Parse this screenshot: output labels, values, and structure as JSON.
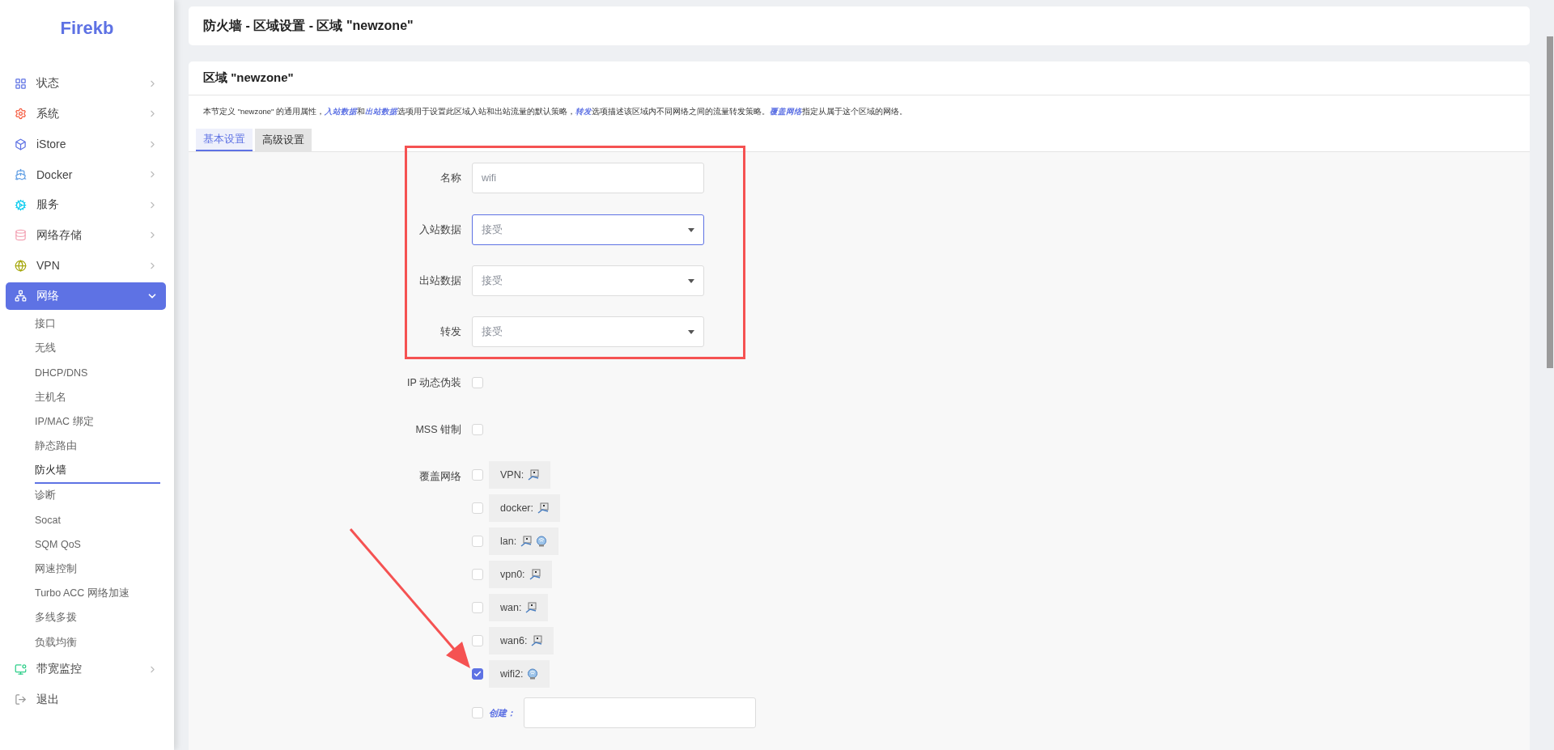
{
  "brand": "Firekb",
  "sidebar": {
    "items": [
      {
        "label": "状态",
        "kind": "menu",
        "expanded": false,
        "selected": false
      },
      {
        "label": "系统",
        "kind": "menu",
        "expanded": false,
        "selected": false
      },
      {
        "label": "iStore",
        "kind": "menu",
        "expanded": false,
        "selected": false
      },
      {
        "label": "Docker",
        "kind": "menu",
        "expanded": false,
        "selected": false
      },
      {
        "label": "服务",
        "kind": "menu",
        "expanded": false,
        "selected": false
      },
      {
        "label": "网络存储",
        "kind": "menu",
        "expanded": false,
        "selected": false
      },
      {
        "label": "VPN",
        "kind": "menu",
        "expanded": false,
        "selected": false
      },
      {
        "label": "网络",
        "kind": "menu",
        "expanded": true,
        "selected": true,
        "children": [
          {
            "label": "接口",
            "selected": false
          },
          {
            "label": "无线",
            "selected": false
          },
          {
            "label": "DHCP/DNS",
            "selected": false
          },
          {
            "label": "主机名",
            "selected": false
          },
          {
            "label": "IP/MAC 绑定",
            "selected": false
          },
          {
            "label": "静态路由",
            "selected": false
          },
          {
            "label": "防火墙",
            "selected": true
          },
          {
            "label": "诊断",
            "selected": false
          },
          {
            "label": "Socat",
            "selected": false
          },
          {
            "label": "SQM QoS",
            "selected": false
          },
          {
            "label": "网速控制",
            "selected": false
          },
          {
            "label": "Turbo ACC 网络加速",
            "selected": false
          },
          {
            "label": "多线多拨",
            "selected": false
          },
          {
            "label": "负载均衡",
            "selected": false
          }
        ]
      },
      {
        "label": "带宽监控",
        "kind": "menu",
        "expanded": false,
        "selected": false
      },
      {
        "label": "退出",
        "kind": "action",
        "selected": false
      }
    ]
  },
  "page_title": "防火墙 - 区域设置 - 区域 \"newzone\"",
  "section": {
    "title": "区域 \"newzone\"",
    "description": [
      {
        "kind": "plain",
        "text": "本节定义 \"newzone\" 的通用属性，"
      },
      {
        "kind": "link",
        "text": "入站数据"
      },
      {
        "kind": "plain",
        "text": "和"
      },
      {
        "kind": "link",
        "text": "出站数据"
      },
      {
        "kind": "plain",
        "text": "选项用于设置此区域入站和出站流量的默认策略，"
      },
      {
        "kind": "link",
        "text": "转发"
      },
      {
        "kind": "plain",
        "text": "选项描述该区域内不同网络之间的流量转发策略。"
      },
      {
        "kind": "link",
        "text": "覆盖网络"
      },
      {
        "kind": "plain",
        "text": "指定从属于这个区域的网络。"
      }
    ],
    "tabs": [
      {
        "label": "基本设置",
        "selected": true
      },
      {
        "label": "高级设置",
        "selected": false
      }
    ],
    "fields": [
      {
        "kind": "text",
        "label": "名称",
        "value": "wifi",
        "focused": false
      },
      {
        "kind": "select",
        "label": "入站数据",
        "value": "接受",
        "focused": true
      },
      {
        "kind": "select",
        "label": "出站数据",
        "value": "接受",
        "focused": false
      },
      {
        "kind": "select",
        "label": "转发",
        "value": "接受",
        "focused": false
      },
      {
        "kind": "checkbox",
        "label": "IP 动态伪装",
        "checked": false
      },
      {
        "kind": "checkbox",
        "label": "MSS 钳制",
        "checked": false
      },
      {
        "kind": "networks",
        "label": "覆盖网络",
        "items": [
          {
            "name": "VPN:",
            "checked": false,
            "devices": [
              {
                "kind": "wired"
              }
            ]
          },
          {
            "name": "docker:",
            "checked": false,
            "devices": [
              {
                "kind": "wired"
              }
            ]
          },
          {
            "name": "lan:",
            "checked": false,
            "devices": [
              {
                "kind": "wired"
              },
              {
                "kind": "wireless"
              }
            ]
          },
          {
            "name": "vpn0:",
            "checked": false,
            "devices": [
              {
                "kind": "wired"
              }
            ]
          },
          {
            "name": "wan:",
            "checked": false,
            "devices": [
              {
                "kind": "wired"
              }
            ]
          },
          {
            "name": "wan6:",
            "checked": false,
            "devices": [
              {
                "kind": "wired"
              }
            ]
          },
          {
            "name": "wifi2:",
            "checked": true,
            "devices": [
              {
                "kind": "wireless"
              }
            ]
          }
        ],
        "create": {
          "label": "创建：",
          "checked": false
        }
      }
    ]
  }
}
